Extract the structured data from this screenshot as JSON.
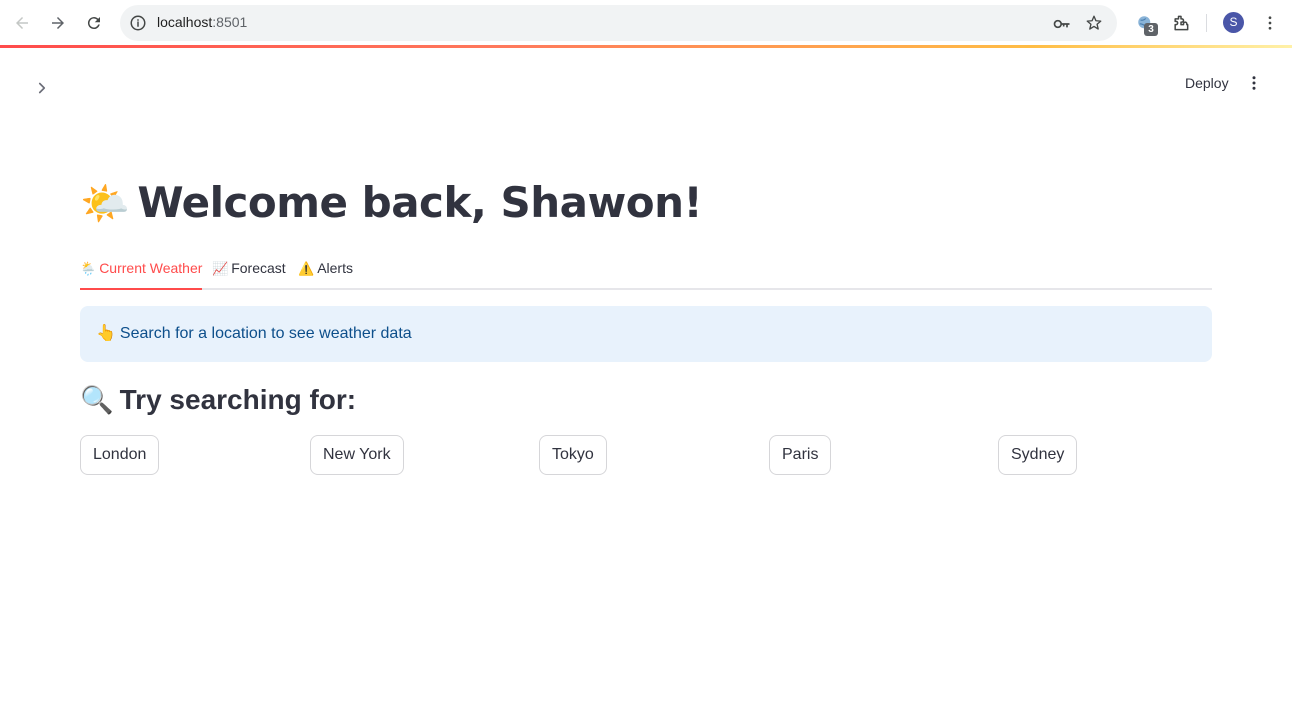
{
  "browser": {
    "url_host": "localhost",
    "url_port": ":8501",
    "extension_badge": "3",
    "profile_initial": "S"
  },
  "app": {
    "deploy_label": "Deploy",
    "title_emoji": "🌤️",
    "title": "Welcome back, Shawon!",
    "tabs": [
      {
        "icon": "🌦️",
        "label": "Current Weather"
      },
      {
        "icon": "📈",
        "label": "Forecast"
      },
      {
        "icon": "⚠️",
        "label": "Alerts"
      }
    ],
    "info": {
      "emoji": "👆",
      "text": "Search for a location to see weather data"
    },
    "subheader": {
      "emoji": "🔍",
      "text": "Try searching for:"
    },
    "cities": [
      "London",
      "New York",
      "Tokyo",
      "Paris",
      "Sydney"
    ]
  },
  "colors": {
    "accent": "#ff4b4b",
    "text": "#31333f",
    "info_bg": "#e8f2fc",
    "info_text": "#0d4f8b"
  }
}
